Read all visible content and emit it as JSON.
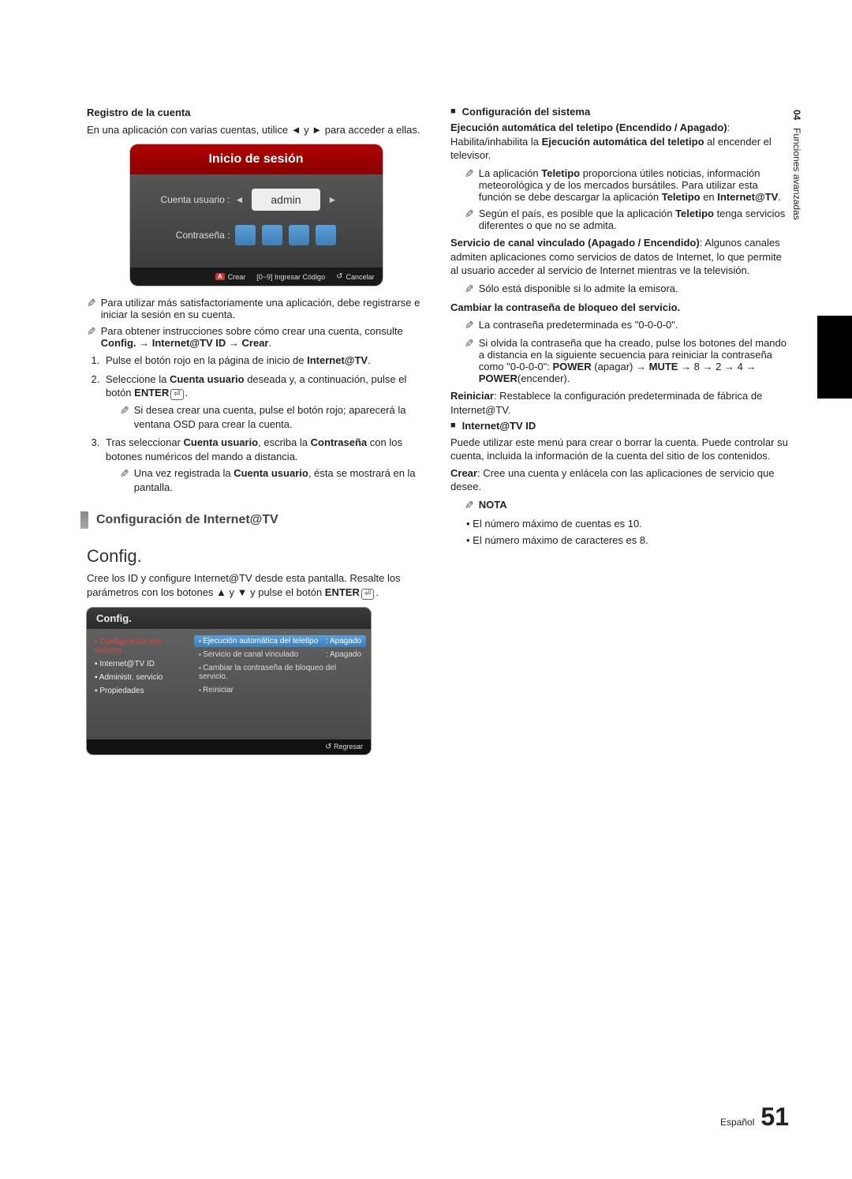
{
  "sideTab": {
    "chapter": "04",
    "title": "Funciones avanzadas"
  },
  "left": {
    "h_registro": "Registro de la cuenta",
    "p_registro": "En una aplicación con varias cuentas, utilice ◄ y ► para acceder a ellas.",
    "login": {
      "title": "Inicio de sesión",
      "userLabel": "Cuenta usuario :",
      "userValue": "admin",
      "passLabel": "Contraseña :",
      "footCreate": "Crear",
      "footCode": "[0~9] Ingresar Código",
      "footCancel": "Cancelar"
    },
    "note1": "Para utilizar más satisfactoriamente una aplicación, debe registrarse e iniciar la sesión en su cuenta.",
    "note2a": "Para obtener instrucciones sobre cómo crear una cuenta, consulte ",
    "note2b": "Config. → Internet@TV ID → Crear",
    "step1a": "Pulse el botón rojo en la página de inicio de ",
    "step1b": "Internet@TV",
    "step2a": "Seleccione la ",
    "step2b": "Cuenta usuario",
    "step2c": " deseada y, a continuación, pulse el botón ",
    "step2d": "ENTER",
    "step2note": "Si desea crear una cuenta, pulse el botón rojo; aparecerá la ventana OSD para crear la cuenta.",
    "step3a": "Tras seleccionar ",
    "step3b": "Cuenta usuario",
    "step3c": ", escriba la ",
    "step3d": "Contraseña",
    "step3e": " con los botones numéricos del mando a distancia.",
    "step3note_a": "Una vez registrada la ",
    "step3note_b": "Cuenta usuario",
    "step3note_c": ", ésta se mostrará en la pantalla.",
    "greyHeading": "Configuración de Internet@TV",
    "h_config": "Config.",
    "p_config_a": "Cree los ID y configure Internet@TV desde esta pantalla. Resalte los parámetros con los botones ▲ y ▼ y pulse el botón ",
    "p_config_b": "ENTER",
    "config": {
      "title": "Config.",
      "sidebar": [
        "Configuración del sistema",
        "Internet@TV ID",
        "Administr. servicio",
        "Propiedades"
      ],
      "rows": [
        {
          "label": "Ejecución automática del teletipo",
          "value": ": Apagado"
        },
        {
          "label": "Servicio de canal vinculado",
          "value": ": Apagado"
        },
        {
          "label": "Cambiar la contraseña de bloqueo del servicio.",
          "value": ""
        },
        {
          "label": "Reiniciar",
          "value": ""
        }
      ],
      "footReturn": "Regresar"
    }
  },
  "right": {
    "h_sys": "Configuración del sistema",
    "ejec_title": "Ejecución automática del teletipo (Encendido / Apagado)",
    "ejec_body_a": ": Habilita/inhabilita la ",
    "ejec_body_b": "Ejecución automática del teletipo",
    "ejec_body_c": " al encender el televisor.",
    "ejec_note1_a": "La aplicación ",
    "ejec_note1_b": "Teletipo",
    "ejec_note1_c": " proporciona útiles noticias, información meteorológica y de los mercados bursátiles. Para utilizar esta función se debe descargar la aplicación ",
    "ejec_note1_d": "Teletipo",
    "ejec_note1_e": " en ",
    "ejec_note1_f": "Internet@TV",
    "ejec_note2_a": "Según el país, es posible que la aplicación ",
    "ejec_note2_b": "Teletipo",
    "ejec_note2_c": " tenga servicios diferentes o que no se admita.",
    "serv_title": "Servicio de canal vinculado (Apagado / Encendido)",
    "serv_body": ": Algunos canales admiten aplicaciones como servicios de datos de Internet, lo que permite al usuario acceder al servicio de Internet mientras ve la televisión.",
    "serv_note": "Sólo está disponible si lo admite la emisora.",
    "pw_title": "Cambiar la contraseña de bloqueo del servicio.",
    "pw_note1": "La contraseña predeterminada es \"0-0-0-0\".",
    "pw_note2_a": "Si olvida la contraseña que ha creado, pulse los botones del mando a distancia en la siguiente secuencia para reiniciar la contraseña como \"0-0-0-0\": ",
    "pw_note2_b": "POWER",
    "pw_note2_c": " (apagar) → ",
    "pw_note2_d": "MUTE",
    "pw_note2_e": " → 8 → 2 → 4 → ",
    "pw_note2_f": "POWER",
    "pw_note2_g": "(encender).",
    "rein_a": "Reiniciar",
    "rein_b": ": Restablece la configuración predeterminada de fábrica de Internet@TV.",
    "h_id": "Internet@TV ID",
    "id_body": "Puede utilizar este menú para crear o borrar la cuenta. Puede controlar su cuenta, incluida la información de la cuenta del sitio de los contenidos.",
    "crear_a": "Crear",
    "crear_b": ": Cree una cuenta y enlácela con las aplicaciones de servicio que desee.",
    "nota_label": "NOTA",
    "nota1": "El número máximo de cuentas es 10.",
    "nota2": "El número máximo de caracteres es 8."
  },
  "footer": {
    "lang": "Español",
    "page": "51"
  }
}
